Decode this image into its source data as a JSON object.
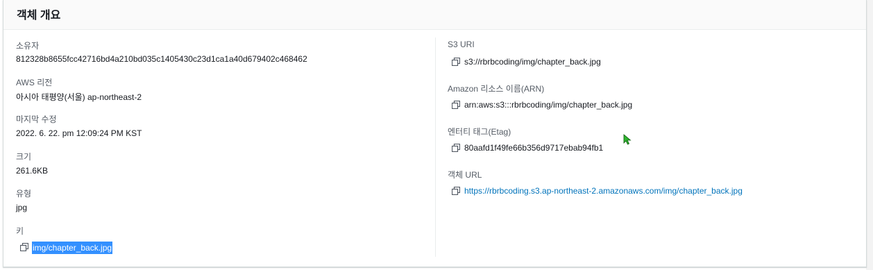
{
  "panel": {
    "title": "객체 개요"
  },
  "left": {
    "owner_label": "소유자",
    "owner_value": "812328b8655fcc42716bd4a210bd035c1405430c23d1ca1a40d679402c468462",
    "region_label": "AWS 리전",
    "region_value": "아시아 태평양(서울) ap-northeast-2",
    "modified_label": "마지막 수정",
    "modified_value": "2022. 6. 22. pm 12:09:24 PM KST",
    "size_label": "크기",
    "size_value": "261.6KB",
    "type_label": "유형",
    "type_value": "jpg",
    "key_label": "키",
    "key_value": "img/chapter_back.jpg"
  },
  "right": {
    "s3uri_label": "S3 URI",
    "s3uri_value": "s3://rbrbcoding/img/chapter_back.jpg",
    "arn_label": "Amazon 리소스 이름(ARN)",
    "arn_value": "arn:aws:s3:::rbrbcoding/img/chapter_back.jpg",
    "etag_label": "엔터티 태그(Etag)",
    "etag_value": "80aafd1f49fe66b356d9717ebab94fb1",
    "url_label": "객체 URL",
    "url_value": "https://rbrbcoding.s3.ap-northeast-2.amazonaws.com/img/chapter_back.jpg"
  },
  "icons": {
    "copy": "copy-icon",
    "cursor": "mouse-cursor-icon"
  },
  "colors": {
    "link": "#0073bb",
    "selection": "#3390ff",
    "cursor": "#2fb52f"
  }
}
